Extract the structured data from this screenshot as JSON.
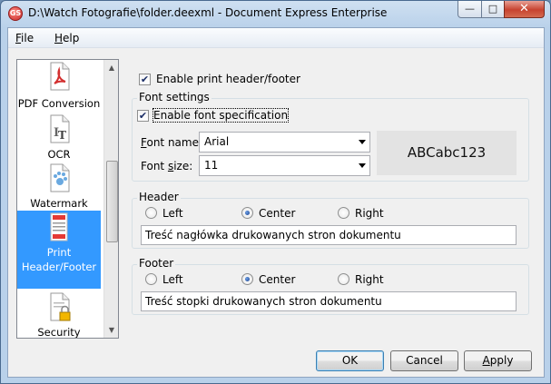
{
  "window": {
    "title": "D:\\Watch Fotografie\\folder.deexml - Document Express Enterprise",
    "app_icon_text": "GS",
    "minimize_glyph": "—",
    "maximize_glyph": "□",
    "close_glyph": "✕"
  },
  "menu": {
    "file": {
      "mnemonic": "F",
      "rest": "ile"
    },
    "help": {
      "mnemonic": "H",
      "rest": "elp"
    }
  },
  "sidebar": {
    "items": [
      {
        "label": "PDF Conversion",
        "icon": "pdf-icon"
      },
      {
        "label": "OCR",
        "icon": "ocr-icon"
      },
      {
        "label": "Watermark",
        "icon": "watermark-icon"
      },
      {
        "label_line1": "Print",
        "label_line2": "Header/Footer",
        "icon": "header-footer-icon",
        "selected": true
      },
      {
        "label": "Security",
        "icon": "security-icon"
      }
    ],
    "scroll_up": "▲",
    "scroll_down": "▼"
  },
  "settings": {
    "enable_header_footer": {
      "label": "Enable print header/footer",
      "checked": true
    },
    "font_settings": {
      "group_label": "Font settings",
      "enable_font_spec": {
        "label": "Enable font specification",
        "checked": true
      },
      "font_name_label_mnemonic": "F",
      "font_name_label_rest": "ont name:",
      "font_name_value": "Arial",
      "font_size_label_pre": "Font ",
      "font_size_label_mnemonic": "s",
      "font_size_label_rest": "ize:",
      "font_size_value": "11",
      "preview_text": "ABCabc123"
    },
    "header": {
      "group_label": "Header",
      "left": "Left",
      "center": "Center",
      "right": "Right",
      "selected": "center",
      "text": "Treść nagłówka drukowanych stron dokumentu"
    },
    "footer": {
      "group_label": "Footer",
      "left": "Left",
      "center": "Center",
      "right": "Right",
      "selected": "center",
      "text": "Treść stopki drukowanych stron dokumentu"
    }
  },
  "buttons": {
    "ok": "OK",
    "cancel": "Cancel",
    "apply_mnemonic": "A",
    "apply_rest": "pply"
  },
  "colors": {
    "selection": "#3399ff",
    "pdf_red": "#d32f2f"
  }
}
